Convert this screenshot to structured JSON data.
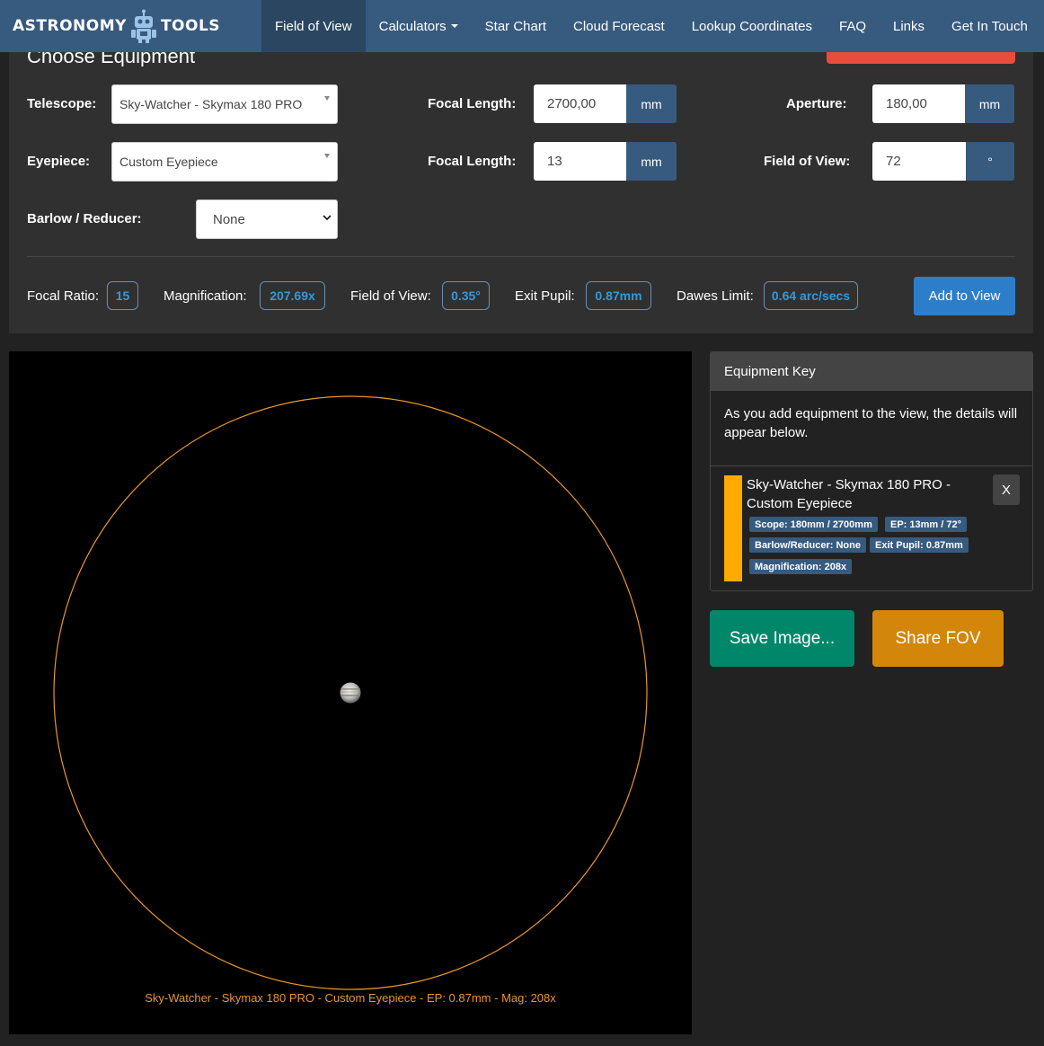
{
  "nav": {
    "brand_left": "ASTRONOMY",
    "brand_right": "TOOLS",
    "items": [
      {
        "label": "Field of View",
        "active": true
      },
      {
        "label": "Calculators",
        "dropdown": true
      },
      {
        "label": "Star Chart"
      },
      {
        "label": "Cloud Forecast"
      },
      {
        "label": "Lookup Coordinates"
      },
      {
        "label": "FAQ"
      },
      {
        "label": "Links"
      },
      {
        "label": "Get In Touch"
      }
    ]
  },
  "equipment": {
    "title": "Choose Equipment",
    "telescope_label": "Telescope:",
    "telescope_value": "Sky-Watcher - Skymax 180 PRO",
    "scope_focal_label": "Focal Length:",
    "scope_focal_value": "2700,00",
    "scope_focal_unit": "mm",
    "aperture_label": "Aperture:",
    "aperture_value": "180,00",
    "aperture_unit": "mm",
    "eyepiece_label": "Eyepiece:",
    "eyepiece_value": "Custom Eyepiece",
    "ep_focal_label": "Focal Length:",
    "ep_focal_value": "13",
    "ep_focal_unit": "mm",
    "fov_label": "Field of View:",
    "fov_value": "72",
    "fov_unit": "°",
    "barlow_label": "Barlow / Reducer:",
    "barlow_value": "None"
  },
  "stats": {
    "focal_ratio_label": "Focal Ratio:",
    "focal_ratio_value": "15",
    "magnification_label": "Magnification:",
    "magnification_value": "207.69x",
    "fov_label": "Field of View:",
    "fov_value": "0.35°",
    "exit_pupil_label": "Exit Pupil:",
    "exit_pupil_value": "0.87mm",
    "dawes_label": "Dawes Limit:",
    "dawes_value": "0.64 arc/secs",
    "add_button": "Add to View"
  },
  "view": {
    "caption": "Sky-Watcher - Skymax 180 PRO - Custom Eyepiece - EP: 0.87mm - Mag: 208x",
    "circle_color": "#e8952a"
  },
  "key": {
    "title": "Equipment Key",
    "intro": "As you add equipment to the view, the details will appear below.",
    "item": {
      "name": "Sky-Watcher - Skymax 180 PRO - Custom Eyepiece",
      "close": "X",
      "color": "#ffaa00",
      "tags": [
        "Scope: 180mm / 2700mm",
        "EP: 13mm / 72°",
        "Barlow/Reducer: None",
        "Exit Pupil: 0.87mm",
        "Magnification: 208x"
      ]
    }
  },
  "actions": {
    "save": "Save Image...",
    "share": "Share FOV"
  },
  "colors": {
    "nav": "#375a7f",
    "save": "#00876a",
    "share": "#d4860a",
    "accent_link": "#3498db"
  }
}
